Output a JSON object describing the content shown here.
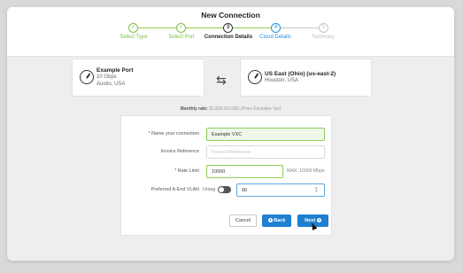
{
  "window": {
    "title": "New Connection"
  },
  "steps": [
    {
      "label": "Select Type",
      "symbol": "✓",
      "state": "done"
    },
    {
      "label": "Select Port",
      "symbol": "✓",
      "state": "done"
    },
    {
      "label": "Connection Details",
      "symbol": "3",
      "state": "current"
    },
    {
      "label": "Cloud Details",
      "symbol": "4",
      "state": "active"
    },
    {
      "label": "Summary",
      "symbol": "5",
      "state": "future"
    }
  ],
  "source_port": {
    "name": "Example Port",
    "speed": "10 Gbps",
    "location": "Austin, USA",
    "icon": "port-gauge-icon"
  },
  "swap_icon": "⇆",
  "destination": {
    "name": "US East (Ohio) (us-east-2)",
    "location": "Houston, USA",
    "icon": "port-gauge-icon"
  },
  "pricing": {
    "label": "Monthly rate:",
    "value": "$1,800.00 USD (Price Excludes Tax)"
  },
  "form": {
    "name_label": "* Name your connection",
    "name_value": "Example VXC",
    "invoice_label": "Invoice Reference",
    "invoice_placeholder": "Invoice Reference",
    "rate_label": "* Rate Limit",
    "rate_value": "10000",
    "rate_max": "MAX: 10000 Mbps",
    "vlan_label": "Preferred A-End VLAN",
    "untag_label": "Untag",
    "untag_on": false,
    "vlan_value": "90"
  },
  "buttons": {
    "cancel": "Cancel",
    "back": "Back",
    "next": "Next"
  },
  "colors": {
    "done": "#7cc248",
    "active": "#2a8fd8",
    "primary": "#1f7fd1"
  }
}
